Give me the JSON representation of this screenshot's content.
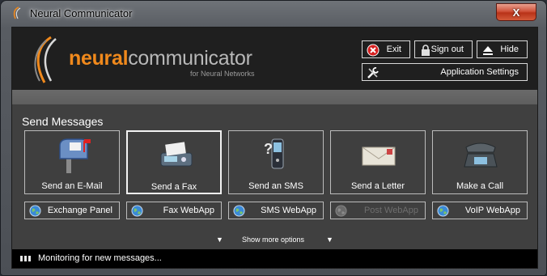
{
  "window": {
    "title": "Neural Communicator",
    "close_label": "X"
  },
  "logo": {
    "neural_prefix": "neural",
    "communicator": "communicator",
    "subtitle": "for Neural Networks"
  },
  "header_buttons": {
    "exit": "Exit",
    "sign_out": "Sign out",
    "hide": "Hide",
    "app_settings": "Application Settings"
  },
  "section_title": "Send Messages",
  "tiles": [
    {
      "label": "Send an E-Mail",
      "icon": "mailbox-icon"
    },
    {
      "label": "Send a Fax",
      "icon": "fax-icon"
    },
    {
      "label": "Send an SMS",
      "icon": "mobile-phone-icon"
    },
    {
      "label": "Send a Letter",
      "icon": "envelope-icon"
    },
    {
      "label": "Make a Call",
      "icon": "telephone-icon"
    }
  ],
  "webapps": [
    {
      "label": "Exchange Panel",
      "enabled": true
    },
    {
      "label": "Fax WebApp",
      "enabled": true
    },
    {
      "label": "SMS WebApp",
      "enabled": true
    },
    {
      "label": "Post WebApp",
      "enabled": false
    },
    {
      "label": "VoIP WebApp",
      "enabled": true
    }
  ],
  "more_options": "Show more options",
  "status": "Monitoring for new messages...",
  "colors": {
    "accent": "#f0891c",
    "close": "#c8432a",
    "header_bg": "#1f1f1f",
    "panel_bg": "#404040"
  }
}
